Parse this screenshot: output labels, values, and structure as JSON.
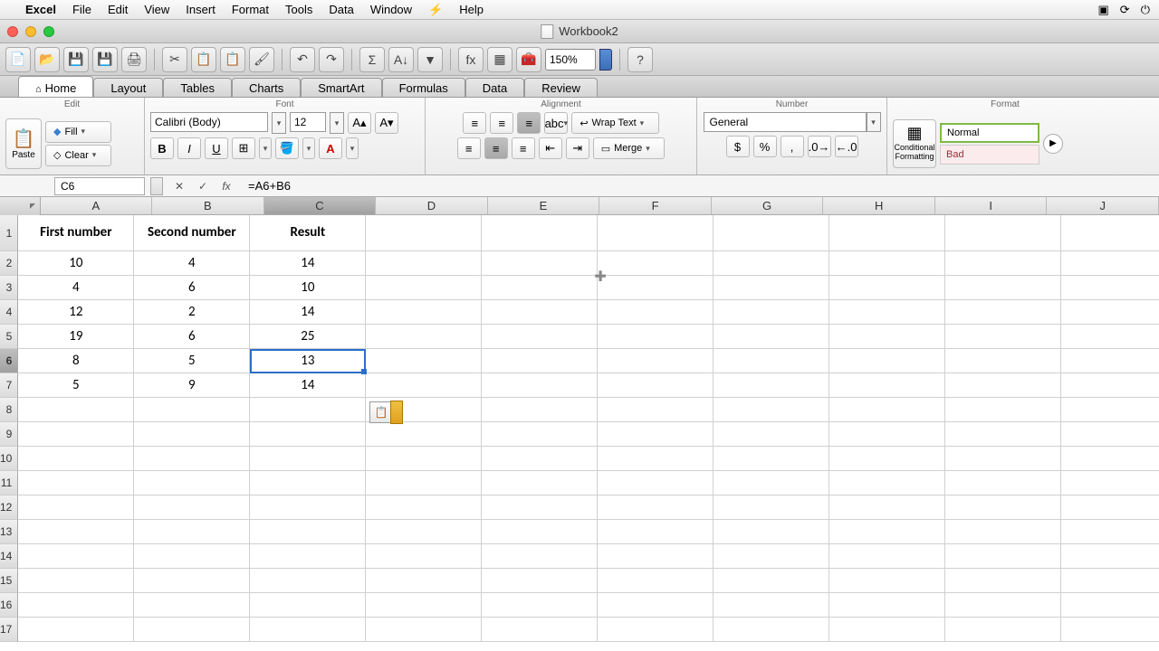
{
  "mac_menu": {
    "app": "Excel",
    "items": [
      "File",
      "Edit",
      "View",
      "Insert",
      "Format",
      "Tools",
      "Data",
      "Window"
    ],
    "help": "Help"
  },
  "window": {
    "title": "Workbook2"
  },
  "toolbar": {
    "zoom": "150%"
  },
  "ribbon_tabs": {
    "home": "Home",
    "layout": "Layout",
    "tables": "Tables",
    "charts": "Charts",
    "smartart": "SmartArt",
    "formulas": "Formulas",
    "data": "Data",
    "review": "Review"
  },
  "ribbon": {
    "edit": {
      "label": "Edit",
      "paste": "Paste",
      "fill": "Fill",
      "clear": "Clear"
    },
    "font": {
      "label": "Font",
      "name": "Calibri (Body)",
      "size": "12"
    },
    "alignment": {
      "label": "Alignment",
      "abc": "abc",
      "wrap": "Wrap Text",
      "merge": "Merge"
    },
    "number": {
      "label": "Number",
      "format": "General"
    },
    "format": {
      "label": "Format",
      "cond": "Conditional Formatting",
      "normal": "Normal",
      "bad": "Bad"
    }
  },
  "formula_bar": {
    "name_box": "C6",
    "formula": "=A6+B6"
  },
  "columns": [
    "A",
    "B",
    "C",
    "D",
    "E",
    "F",
    "G",
    "H",
    "I",
    "J"
  ],
  "rows": [
    "1",
    "2",
    "3",
    "4",
    "5",
    "6",
    "7",
    "8",
    "9",
    "10",
    "11",
    "12",
    "13",
    "14",
    "15",
    "16",
    "17"
  ],
  "grid": {
    "headers": {
      "A": "First number",
      "B": "Second number",
      "C": "Result"
    },
    "data": [
      {
        "A": "10",
        "B": "4",
        "C": "14"
      },
      {
        "A": "4",
        "B": "6",
        "C": "10"
      },
      {
        "A": "12",
        "B": "2",
        "C": "14"
      },
      {
        "A": "19",
        "B": "6",
        "C": "25"
      },
      {
        "A": "8",
        "B": "5",
        "C": "13"
      },
      {
        "A": "5",
        "B": "9",
        "C": "14"
      }
    ]
  },
  "selection": {
    "cell": "C6",
    "row": 6,
    "col": "C"
  }
}
